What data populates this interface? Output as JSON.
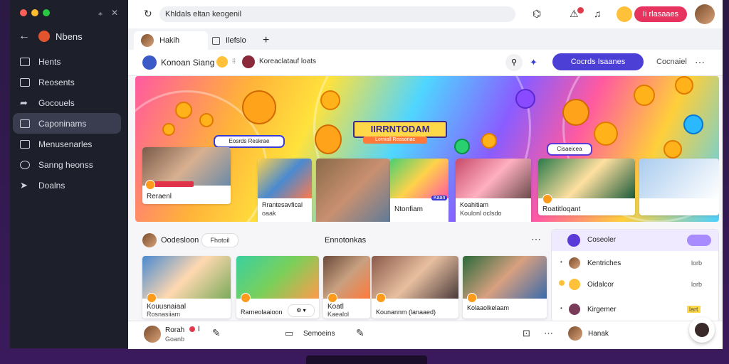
{
  "sidebar": {
    "title": "Nbens",
    "items": [
      {
        "label": "Hents"
      },
      {
        "label": "Reosents"
      },
      {
        "label": "Gocouels"
      },
      {
        "label": "Caponinams",
        "active": true
      },
      {
        "label": "Menusenarles"
      },
      {
        "label": "Sanng heonss"
      },
      {
        "label": "Doalns"
      }
    ]
  },
  "topbar": {
    "address": "Khldals eltan keogenil",
    "action_button": "Ii rlasaaes"
  },
  "tabs": [
    {
      "label": "Hakih"
    },
    {
      "label": "Ilefslo"
    }
  ],
  "header": {
    "title": "Konoan Siang",
    "subtitle": "Koreaclatauf loats",
    "primary_button": "Cocrds Isaanes",
    "right_link": "Cocnaiel"
  },
  "hero": {
    "title": "IIRRNTODAM",
    "tagline": "Lorniall Reasonac",
    "pill_left": "Eosrds Reskrae",
    "pill_right": "Cisaeicea"
  },
  "top_cards": [
    {
      "caption": "Reraenl"
    },
    {
      "caption": "Rrantesavfical",
      "caption2": "oaak"
    },
    {
      "caption": "Ntonfiam",
      "badge": "Kaan"
    },
    {
      "caption": "Koahitiam",
      "caption2": "Koulonl oclsdo"
    },
    {
      "caption": "Roatitloqant"
    }
  ],
  "section": {
    "title": "Oodesloon",
    "pill": "Fhotoil",
    "center_text": "Ennotonkas"
  },
  "bottom_cards": [
    {
      "caption": "Kouusnaiaal",
      "caption2": "Rosnasiiam"
    },
    {
      "caption": "Rarneolaaioon"
    },
    {
      "caption": "Koatl",
      "caption2": "Kaealol"
    },
    {
      "caption": "Kounannm (lanaaed)"
    },
    {
      "caption": "Kolaaolkelaam"
    }
  ],
  "right_panel": {
    "title": "Coseoler",
    "rows": [
      {
        "label": "Kentriches",
        "trail": "lorb"
      },
      {
        "label": "Oidalcor",
        "trail": "lorb"
      },
      {
        "label": "Kirgemer",
        "trail": "lart"
      }
    ]
  },
  "bottombar": {
    "user": "Rorah",
    "user_sub": "Goanb",
    "center": "Semoeins",
    "right_user": "Hanak"
  }
}
